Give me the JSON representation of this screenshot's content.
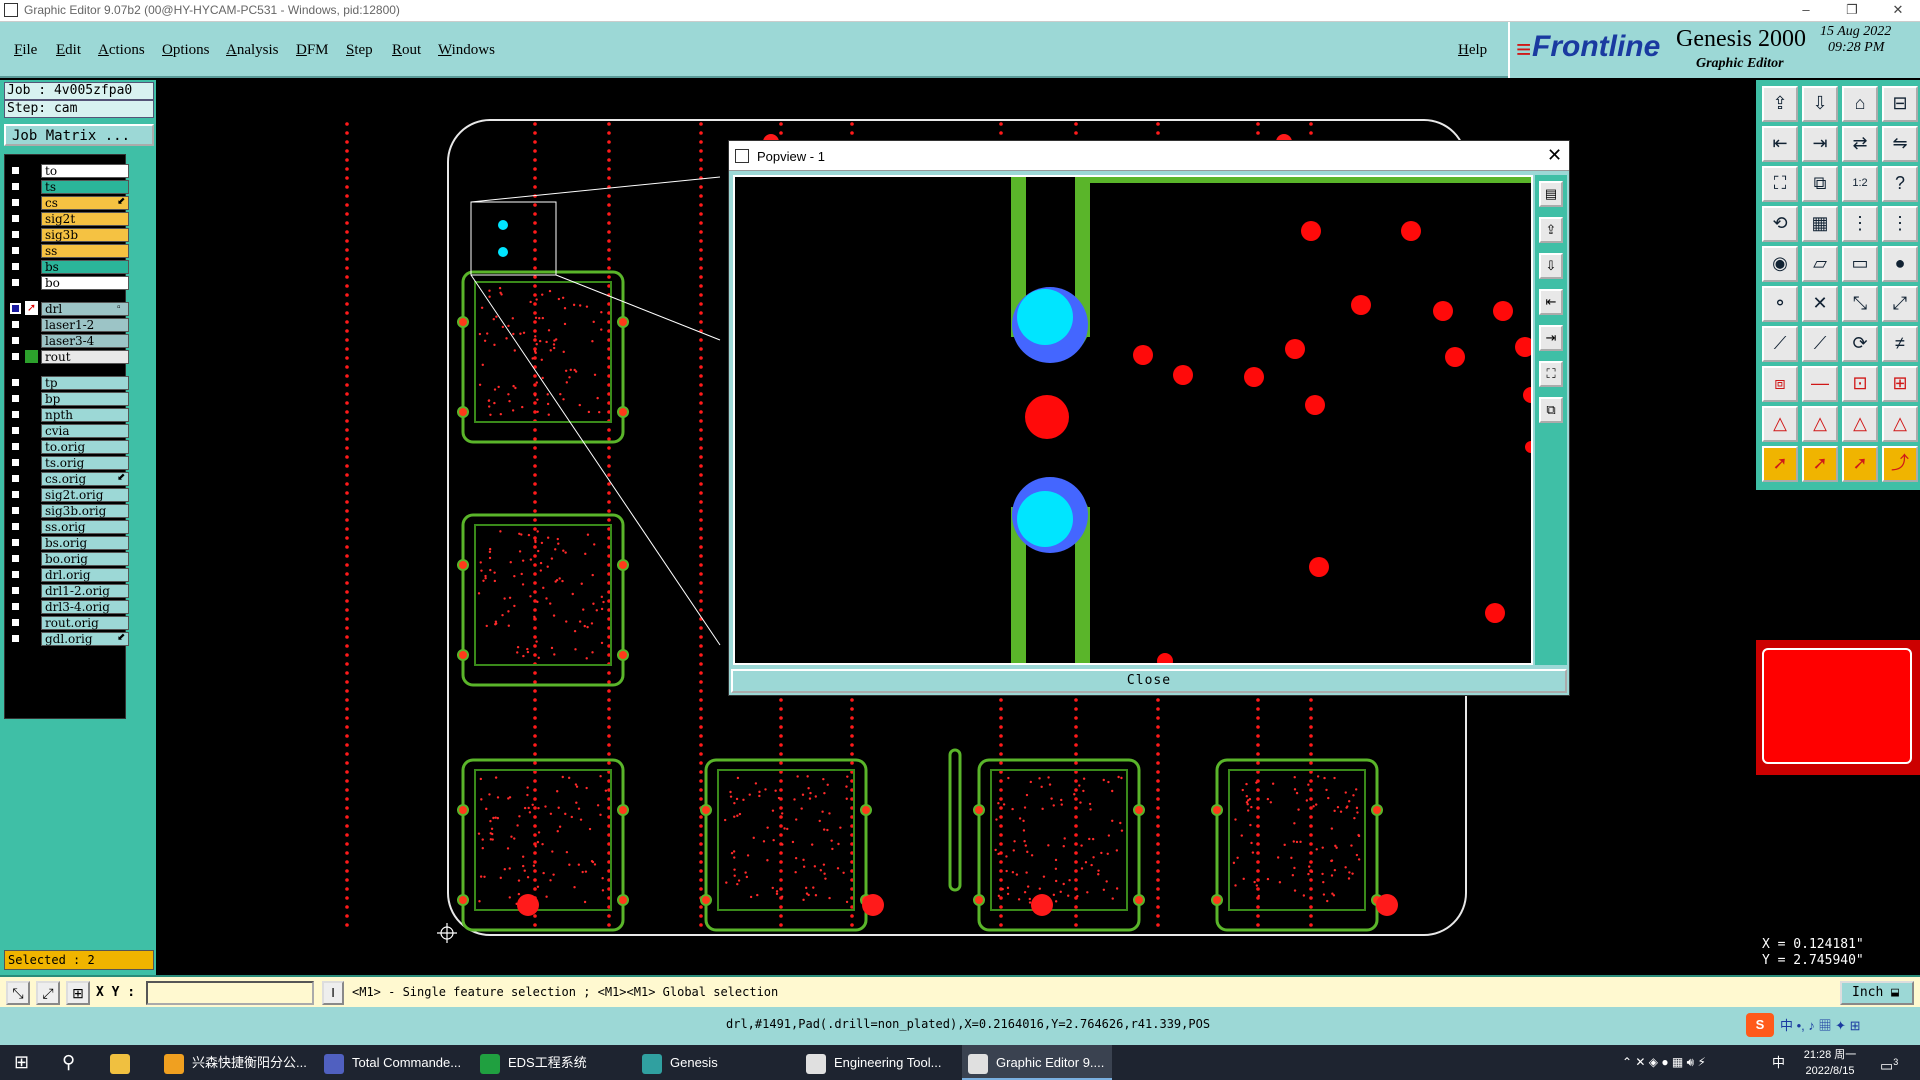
{
  "window": {
    "title": "Graphic Editor 9.07b2 (00@HY-HYCAM-PC531 - Windows, pid:12800)",
    "minimize": "–",
    "maximize": "❐",
    "close": "✕"
  },
  "menu": {
    "items": [
      "File",
      "Edit",
      "Actions",
      "Options",
      "Analysis",
      "DFM",
      "Step",
      "Rout",
      "Windows"
    ],
    "help": "Help"
  },
  "brand": {
    "logo": "Frontline",
    "product": "Genesis 2000",
    "subtitle": "Graphic Editor",
    "date": "15 Aug 2022",
    "time": "09:28 PM",
    "colors": {
      "accent": "#d01818",
      "logo": "#1a3aa0"
    }
  },
  "job": {
    "job_line": "Job : 4v005zfpa0",
    "step_line": "Step: cam",
    "matrix_button": "Job Matrix ..."
  },
  "layers": {
    "group1": [
      {
        "name": "to",
        "color": "#ffffff"
      },
      {
        "name": "ts",
        "color": "#2bb59a"
      },
      {
        "name": "cs",
        "color": "#f5c242",
        "flag": "⬋"
      },
      {
        "name": "sig2t",
        "color": "#f5c242"
      },
      {
        "name": "sig3b",
        "color": "#f5c242"
      },
      {
        "name": "ss",
        "color": "#f5c242"
      },
      {
        "name": "bs",
        "color": "#2bb59a"
      },
      {
        "name": "bo",
        "color": "#ffffff"
      }
    ],
    "group2": [
      {
        "name": "drl",
        "color": "#9cc4c6",
        "active": true,
        "flag": "▫"
      },
      {
        "name": "laser1-2",
        "color": "#9cc4c6"
      },
      {
        "name": "laser3-4",
        "color": "#9cc4c6"
      },
      {
        "name": "rout",
        "color": "#e8e8e8",
        "swatch": "#2ca02c"
      }
    ],
    "group3": [
      {
        "name": "tp",
        "color": "#9cd8d6"
      },
      {
        "name": "bp",
        "color": "#9cd8d6"
      },
      {
        "name": "npth",
        "color": "#9cd8d6"
      },
      {
        "name": "cvia",
        "color": "#9cd8d6"
      },
      {
        "name": "to.orig",
        "color": "#9cd8d6"
      },
      {
        "name": "ts.orig",
        "color": "#9cd8d6"
      },
      {
        "name": "cs.orig",
        "color": "#9cd8d6",
        "flag": "⬋"
      },
      {
        "name": "sig2t.orig",
        "color": "#9cd8d6"
      },
      {
        "name": "sig3b.orig",
        "color": "#9cd8d6"
      },
      {
        "name": "ss.orig",
        "color": "#9cd8d6"
      },
      {
        "name": "bs.orig",
        "color": "#9cd8d6"
      },
      {
        "name": "bo.orig",
        "color": "#9cd8d6"
      },
      {
        "name": "drl.orig",
        "color": "#9cd8d6"
      },
      {
        "name": "drl1-2.orig",
        "color": "#9cd8d6"
      },
      {
        "name": "drl3-4.orig",
        "color": "#9cd8d6"
      },
      {
        "name": "rout.orig",
        "color": "#9cd8d6"
      },
      {
        "name": "gdl.orig",
        "color": "#9cd8d6",
        "flag": "⬋"
      }
    ]
  },
  "status": {
    "selected": "Selected : 2",
    "xy_label": "X Y :",
    "xy_value": "",
    "hint": "<M1> - Single feature selection ; <M1><M1> Global selection",
    "units": "Inch",
    "feature_info": "drl,#1491,Pad(.drill=non_plated),X=0.2164016,Y=2.764626,r41.339,POS",
    "coord_x": "X = 0.124181\"",
    "coord_y": "Y = 2.745940\""
  },
  "popview": {
    "title": "Popview - 1",
    "close_label": "Close"
  },
  "taskbar": {
    "items": [
      {
        "label": "兴森快捷衡阳分公...",
        "icon": "#f0a020"
      },
      {
        "label": "Total Commande...",
        "icon": "#5060c0"
      },
      {
        "label": "EDS工程系统",
        "icon": "#20a040"
      },
      {
        "label": "Genesis",
        "icon": "#30a0a0"
      },
      {
        "label": "Engineering Tool...",
        "icon": "#e0e0e0"
      },
      {
        "label": "Graphic Editor 9....",
        "icon": "#e0e0e0"
      }
    ],
    "clock_time": "21:28 周一",
    "clock_date": "2022/8/15",
    "ime": "中",
    "notif_count": "3"
  }
}
